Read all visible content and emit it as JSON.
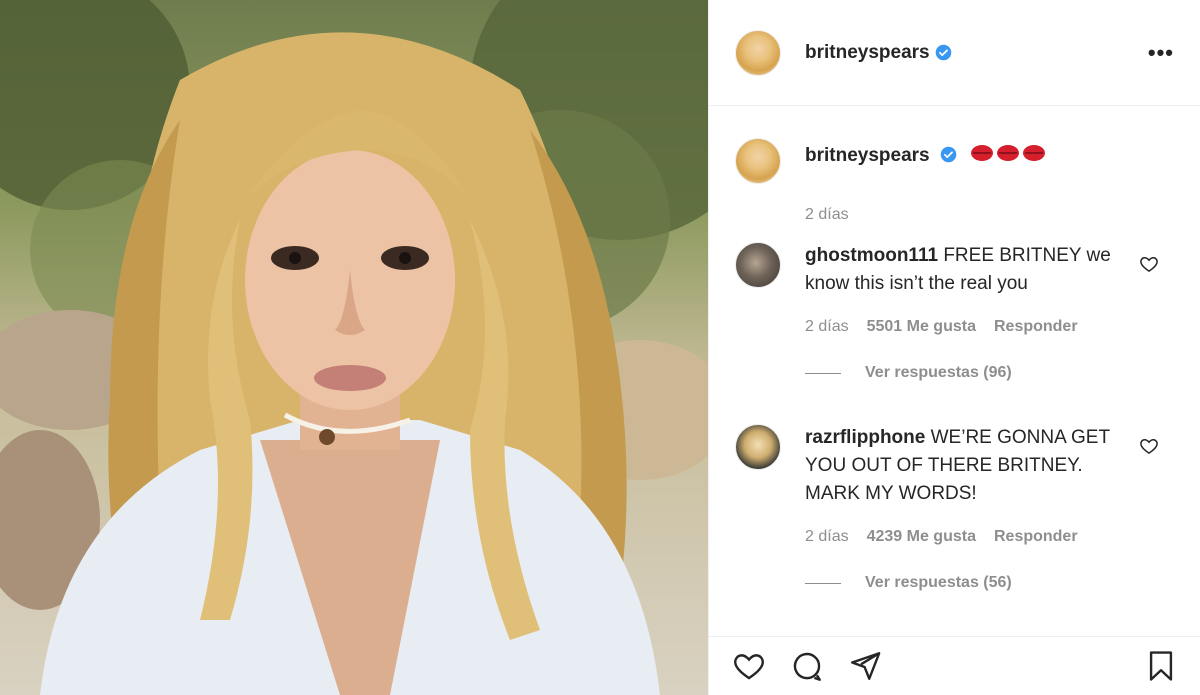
{
  "post": {
    "author": "britneyspears",
    "caption_emoji": "💋💋💋",
    "caption_time": "2 días"
  },
  "comments": [
    {
      "user": "ghostmoon111",
      "text": "FREE BRITNEY we know this isn’t the real you",
      "time": "2 días",
      "likes": "5501 Me gusta",
      "reply": "Responder",
      "view_replies": "Ver respuestas (96)"
    },
    {
      "user": "razrflipphone",
      "text": "WE’RE GONNA GET YOU OUT OF THERE BRITNEY. MARK MY WORDS!",
      "time": "2 días",
      "likes": "4239 Me gusta",
      "reply": "Responder",
      "view_replies": "Ver respuestas (56)"
    }
  ],
  "icons": {
    "more": "more-options-icon",
    "verified": "verified-badge-icon",
    "like": "heart-icon",
    "comment": "comment-icon",
    "share": "send-icon",
    "save": "bookmark-icon"
  },
  "colors": {
    "verified": "#3897f0",
    "text": "#262626",
    "muted": "#8e8e8e",
    "border": "#efefef"
  }
}
